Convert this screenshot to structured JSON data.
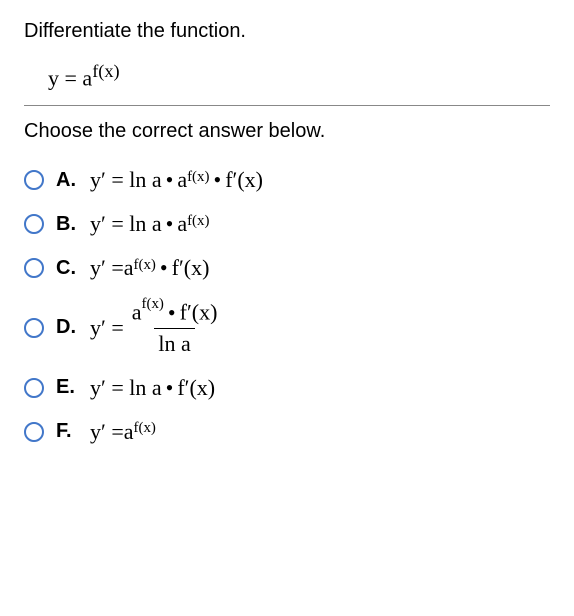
{
  "prompt": "Differentiate the function.",
  "given": {
    "lhs": "y =",
    "base": "a",
    "exp": "f(x)"
  },
  "instruction": "Choose the correct answer below.",
  "sup_fx": "f(x)",
  "dot": "•",
  "options": {
    "A": {
      "letter": "A.",
      "p1": "y′ = ln a",
      "base": "a",
      "p2": "f′(x)"
    },
    "B": {
      "letter": "B.",
      "p1": "y′ = ln a",
      "base": "a"
    },
    "C": {
      "letter": "C.",
      "p1": "y′ =",
      "base": "a",
      "p2": "f′(x)"
    },
    "D": {
      "letter": "D.",
      "p1": "y′ =",
      "num_base": "a",
      "num_p2": "f′(x)",
      "den": "ln a"
    },
    "E": {
      "letter": "E.",
      "p1": "y′ = ln a",
      "p2": "f′(x)"
    },
    "F": {
      "letter": "F.",
      "p1": "y′ =",
      "base": "a"
    }
  }
}
